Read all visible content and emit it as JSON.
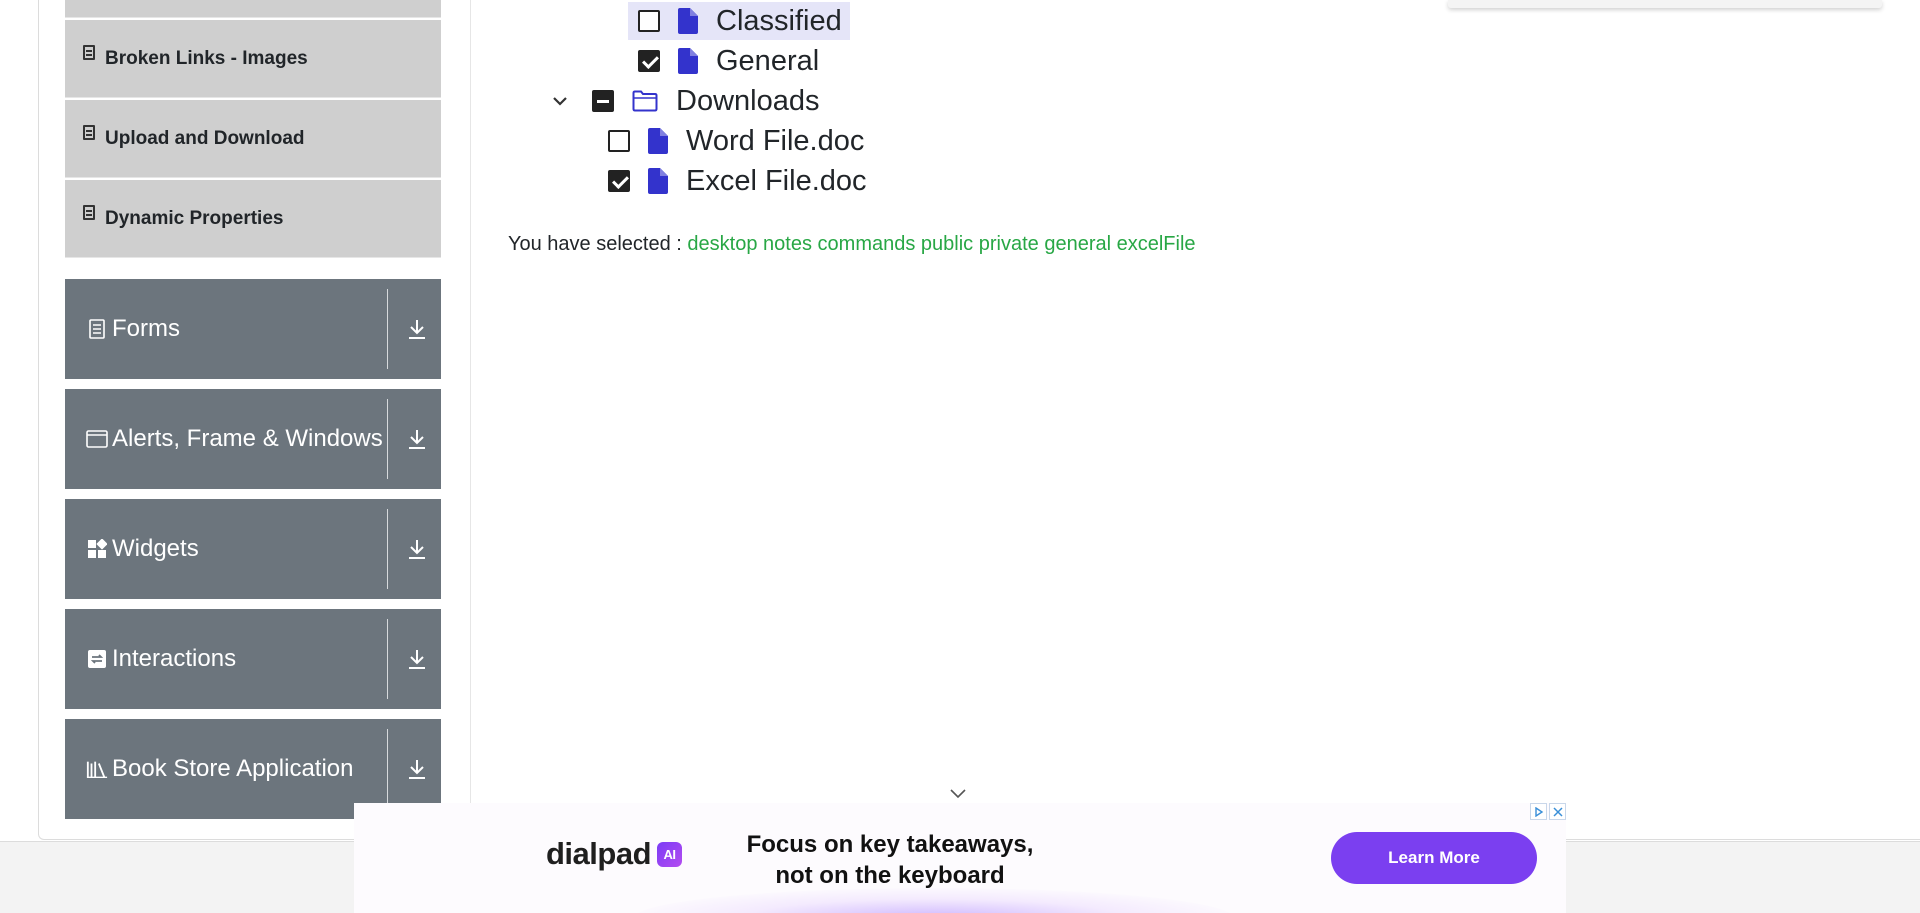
{
  "sidebar": {
    "sub_items": [
      {
        "label": "Broken Links - Images"
      },
      {
        "label": "Upload and Download"
      },
      {
        "label": "Dynamic Properties"
      }
    ],
    "groups": [
      {
        "label": "Forms",
        "icon": "document-icon"
      },
      {
        "label": "Alerts, Frame & Windows",
        "icon": "window-icon"
      },
      {
        "label": "Widgets",
        "icon": "widgets-icon"
      },
      {
        "label": "Interactions",
        "icon": "interactions-icon"
      },
      {
        "label": "Book Store Application",
        "icon": "books-icon"
      }
    ]
  },
  "tree": {
    "nodes": [
      {
        "label": "Classified",
        "state": "unchecked",
        "type": "file",
        "highlighted": true
      },
      {
        "label": "General",
        "state": "checked",
        "type": "file"
      },
      {
        "label": "Downloads",
        "state": "partial",
        "type": "folder",
        "expanded": true
      },
      {
        "label": "Word File.doc",
        "state": "unchecked",
        "type": "file"
      },
      {
        "label": "Excel File.doc",
        "state": "checked",
        "type": "file"
      }
    ]
  },
  "result": {
    "prefix": "You have selected :",
    "items": [
      "desktop",
      "notes",
      "commands",
      "public",
      "private",
      "general",
      "excelFile"
    ]
  },
  "ad": {
    "brand": "dialpad",
    "badge": "AI",
    "headline_line1": "Focus on key takeaways,",
    "headline_line2": "not on the keyboard",
    "cta": "Learn More"
  },
  "colors": {
    "sidebar_group": "#6c757d",
    "sidebar_sub": "#cfcfcf",
    "tree_icon": "#3333cc",
    "selected_text": "#28a745",
    "ad_cta": "#7b3ff0"
  }
}
